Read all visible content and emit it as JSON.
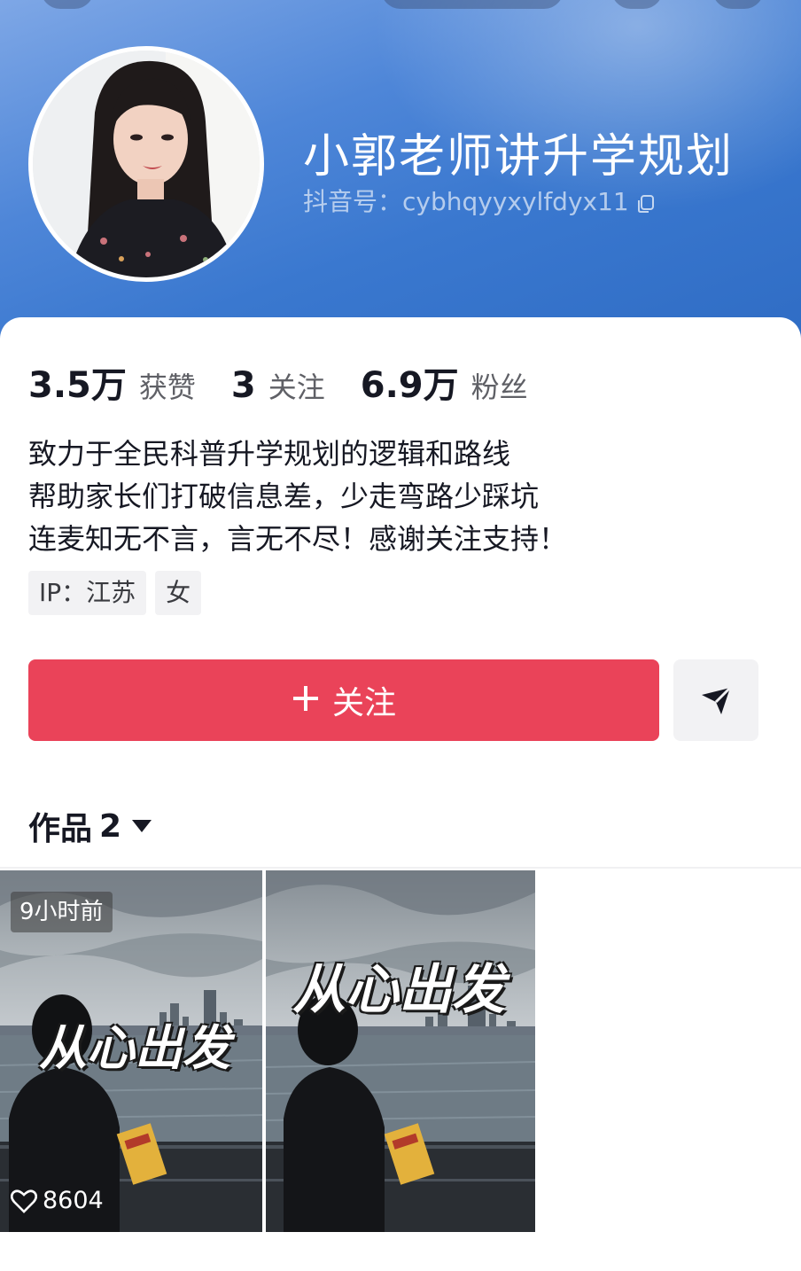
{
  "profile": {
    "nickname": "小郭老师讲升学规划",
    "douyin_id": "抖音号：cybhqyyxylfdyx11",
    "stats": [
      {
        "value": "3.5万",
        "label": "获赞"
      },
      {
        "value": "3",
        "label": "关注"
      },
      {
        "value": "6.9万",
        "label": "粉丝"
      }
    ],
    "bio": [
      "致力于全民科普升学规划的逻辑和路线",
      "帮助家长们打破信息差，少走弯路少踩坑",
      "连麦知无不言，言无不尽！感谢关注支持！"
    ],
    "tags": [
      "IP：江苏",
      "女"
    ]
  },
  "actions": {
    "follow_label": "关注",
    "follow_icon": "plus-icon",
    "share_icon": "send-icon"
  },
  "works": {
    "label": "作品",
    "count": "2",
    "items": [
      {
        "caption": "从心出发",
        "time": "9小时前",
        "likes": "8604"
      },
      {
        "caption": "从心出发"
      }
    ]
  },
  "colors": {
    "banner": "#3a78cf",
    "follow_button": "#ea4359"
  }
}
